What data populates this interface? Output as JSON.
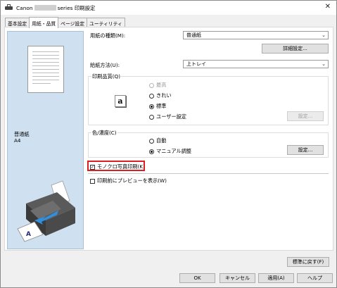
{
  "window": {
    "title_prefix": "Canon",
    "title_suffix": "series 印刷設定",
    "close_glyph": "✕"
  },
  "tabs": [
    {
      "label": "基本設定",
      "active": false
    },
    {
      "label": "用紙・品質",
      "active": true
    },
    {
      "label": "ページ設定",
      "active": false
    },
    {
      "label": "ユーティリティ",
      "active": false
    }
  ],
  "preview": {
    "paper_type": "普通紙",
    "paper_size": "A4"
  },
  "media": {
    "label": "用紙の種類(M):",
    "value": "普通紙",
    "details_button": "詳細設定..."
  },
  "paper_source": {
    "label": "給紙方法(U):",
    "value": "上トレイ"
  },
  "print_quality": {
    "group_label": "印刷品質(Q)",
    "icon_glyph": "a",
    "options": [
      {
        "label": "最高",
        "selected": false,
        "disabled": true
      },
      {
        "label": "きれい",
        "selected": false,
        "disabled": false
      },
      {
        "label": "標準",
        "selected": true,
        "disabled": false
      },
      {
        "label": "ユーザー設定",
        "selected": false,
        "disabled": false
      }
    ],
    "settings_button": "設定..."
  },
  "color_intensity": {
    "group_label": "色/濃度(C)",
    "options": [
      {
        "label": "自動",
        "selected": false
      },
      {
        "label": "マニュアル調整",
        "selected": true
      }
    ],
    "settings_button": "設定..."
  },
  "grayscale": {
    "label": "モノクロ写真印刷(K)",
    "checked": true
  },
  "preview_before_print": {
    "label": "印刷前にプレビューを表示(W)",
    "checked": false
  },
  "footer": {
    "defaults_button": "標準に戻す(F)",
    "ok": "OK",
    "cancel": "キャンセル",
    "apply": "適用(A)",
    "help": "ヘルプ"
  },
  "colors": {
    "highlight": "#d7201f",
    "preview_bg": "#cfe0f1"
  }
}
